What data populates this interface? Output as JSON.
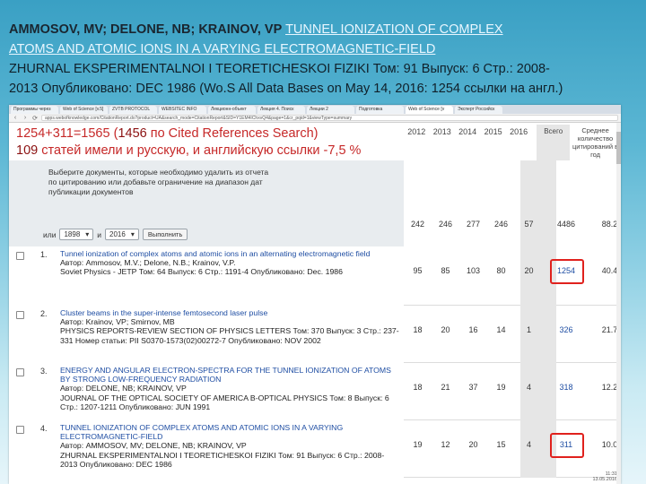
{
  "slide": {
    "authors": "AMMOSOV, MV; DELONE, NB; KRAINOV, VP",
    "title_link": "TUNNEL IONIZATION OF COMPLEX ATOMS AND ATOMIC IONS IN A VARYING ELECTROMAGNETIC-FIELD",
    "title_link_line1": "TUNNEL IONIZATION OF COMPLEX",
    "title_link_line2": "ATOMS AND ATOMIC IONS IN A VARYING ELECTROMAGNETIC-FIELD",
    "journal_line1": "ZHURNAL EKSPERIMENTALNOI I TEORETICHESKOI FIZIKI   Том: 91   Выпуск: 6   Стр.: 2008-",
    "journal_line2": "2013   Опубликовано: DEC 1986 (Wo.S All Data Bases on May 14, 2016: 1254 ссылки на англ.)"
  },
  "browser": {
    "tabs": [
      "Программы через",
      "Web of Science [v.5]",
      "",
      "ZVTB PROTOCOL",
      "WEBSITEС INFO",
      "Лекционн-объект",
      "Лекция 4. Поиск",
      "Лекции 2",
      "Подготовка",
      "Web of Science [v",
      "",
      "Эксперт Российск"
    ],
    "url": "apps.webofknowledge.com/CitationReport.do?product=UA&search_mode=CitationReport&SID=Y1EM4IChxvQ4&page=1&cr_pqid=1&viewType=summary"
  },
  "notes": {
    "line1_prefix": "1254+311=1565 (",
    "line1_strong": "1456",
    "line1_suffix": " по Cited References Search)",
    "line2_strong": "109",
    "line2_suffix": " статей имели и русскую, и английскую ссылки -7,5 %"
  },
  "header": {
    "years": [
      "2012",
      "2013",
      "2014",
      "2015",
      "2016"
    ],
    "total_label": "Всего",
    "avg_label": "Среднее количество цитирований в год"
  },
  "filter": {
    "instruction": "Выберите документы, которые необходимо удалить из отчета по цитированию или добавьте ограничение на диапазон дат публикации документов",
    "from_label": "или",
    "from_year": "1898",
    "to_label": "и",
    "to_year": "2016",
    "exec_label": "Выполнить"
  },
  "totals": {
    "years": [
      "242",
      "246",
      "277",
      "246",
      "57"
    ],
    "total": "4486",
    "avg": "88.20"
  },
  "records": [
    {
      "num": "1.",
      "title": "Tunnel ionization of complex atoms and atomic ions in an alternating electromagnetic field",
      "author": "Автор: Ammosov, M.V.; Delone, N.B.; Krainov, V.P.",
      "source": "Soviet Physics - JETP  Том: 64   Выпуск: 6   Стр.: 1191-4   Опубликовано: Dec. 1986",
      "years": [
        "95",
        "85",
        "103",
        "80",
        "20"
      ],
      "total": "1254",
      "avg": "40.45"
    },
    {
      "num": "2.",
      "title": "Cluster beams in the super-intense femtosecond laser pulse",
      "author": "Автор: Krainov, VP; Smirnov, MB",
      "source": "PHYSICS REPORTS-REVIEW SECTION OF PHYSICS LETTERS  Том: 370   Выпуск: 3   Стр.: 237-331   Номер статьи: PII S0370-1573(02)00272-7   Опубликовано: NOV 2002",
      "years": [
        "18",
        "20",
        "16",
        "14",
        "1"
      ],
      "total": "326",
      "avg": "21.73"
    },
    {
      "num": "3.",
      "title": "ENERGY AND ANGULAR ELECTRON-SPECTRA FOR THE TUNNEL IONIZATION OF ATOMS BY STRONG LOW-FREQUENCY RADIATION",
      "author": "Автор: DELONE, NB; KRAINOV, VP",
      "source": "JOURNAL OF THE OPTICAL SOCIETY OF AMERICA B-OPTICAL PHYSICS  Том: 8   Выпуск: 6   Стр.: 1207-1211   Опубликовано: JUN 1991",
      "years": [
        "18",
        "21",
        "37",
        "19",
        "4"
      ],
      "total": "318",
      "avg": "12.23"
    },
    {
      "num": "4.",
      "title": "TUNNEL IONIZATION OF COMPLEX ATOMS AND ATOMIC IONS IN A VARYING ELECTROMAGNETIC-FIELD",
      "author": "Автор: AMMOSOV, MV; DELONE, NB; KRAINOV, VP",
      "source": "ZHURNAL EKSPERIMENTALNOI I TEORETICHESKOI FIZIKI  Том: 91   Выпуск: 6   Стр.: 2008-2013   Опубликовано: DEC 1986",
      "years": [
        "19",
        "12",
        "20",
        "15",
        "4"
      ],
      "total": "311",
      "avg": "10.03"
    }
  ],
  "stamp": {
    "time": "11:31",
    "date": "13.05.2016"
  },
  "colors": {
    "highlight": "#e0211d",
    "link": "#1f4ea3",
    "note": "#c62828"
  }
}
